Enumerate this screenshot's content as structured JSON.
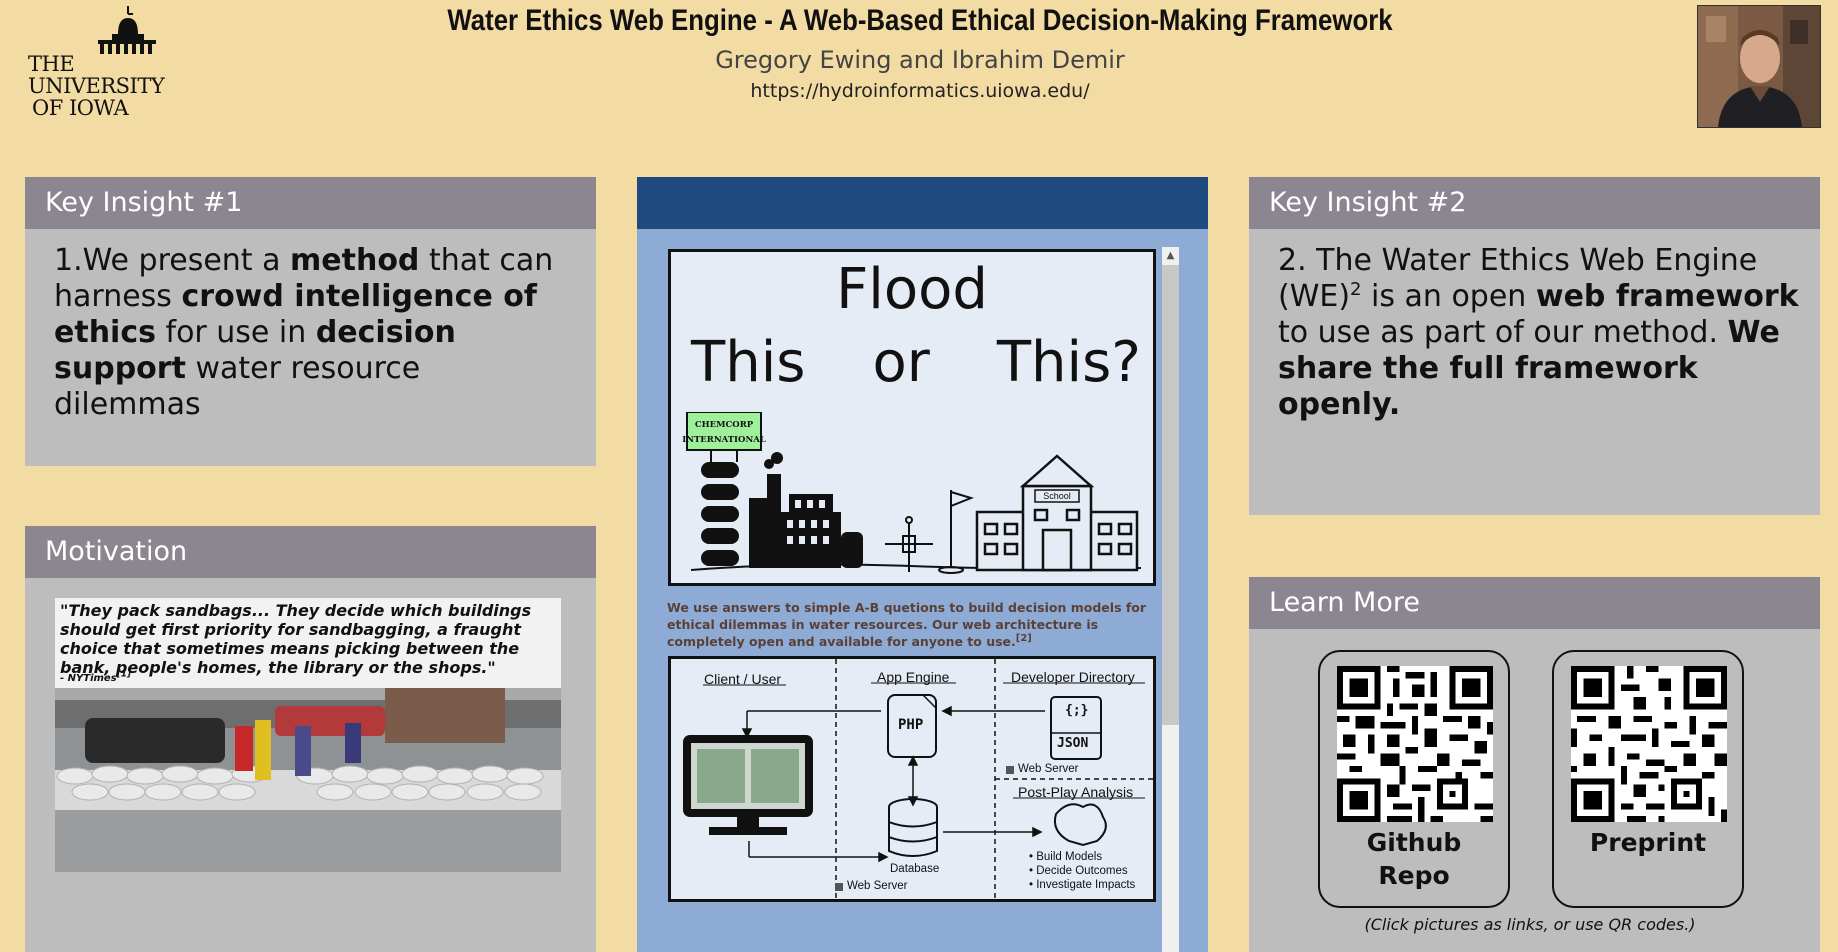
{
  "header": {
    "university_line1": "THE",
    "university_line2": "UNIVERSITY",
    "university_line3": "OF IOWA",
    "title": "Water Ethics Web Engine - A Web-Based Ethical Decision-Making Framework",
    "authors": "Gregory Ewing and Ibrahim Demir",
    "url": "https://hydroinformatics.uiowa.edu/"
  },
  "insight1": {
    "heading": "Key Insight #1",
    "t1": "1.We present a ",
    "b1": "method",
    "t2": " that can harness ",
    "b2": "crowd intelligence of ethics",
    "t3": " for use in ",
    "b3": "decision support",
    "t4": " water resource dilemmas"
  },
  "motivation": {
    "heading": "Motivation",
    "quote": "\"They pack sandbags... They decide which buildings should get first priority for sandbagging, a fraught choice that sometimes means picking between the bank, people's homes, the library or the shops.\"",
    "source": "- NYTimes",
    "source_ref": "[1]"
  },
  "center": {
    "flood": "Flood",
    "this1": "This",
    "or": "or",
    "this2": "This?",
    "sign_line1": "CHEMCORP",
    "sign_line2": "INTERNATIONAL",
    "school_sign": "School",
    "caption": "We use answers to simple A-B quetions to build decision models for ethical dilemmas in water resources. Our web architecture is completely open and available for anyone to use.",
    "caption_ref": "[2]",
    "arch": {
      "client": "Client / User",
      "app": "App Engine",
      "dev": "Developer Directory",
      "php": "PHP",
      "json": "JSON",
      "json_icon": "{;}",
      "web_server_1": "Web Server",
      "web_server_2": "Web Server",
      "post_play": "Post-Play Analysis",
      "database": "Database",
      "bullet1": "Build Models",
      "bullet2": "Decide Outcomes",
      "bullet3": "Investigate Impacts"
    }
  },
  "insight2": {
    "heading": "Key Insight #2",
    "t1": "2. The Water Ethics Web Engine (WE)",
    "sup": "2",
    "t2": " is an open ",
    "b1": "web framework",
    "t3": " to use as part of our method. ",
    "b2": "We share the full framework openly."
  },
  "learn": {
    "heading": "Learn More",
    "github_line1": "Github",
    "github_line2": "Repo",
    "preprint": "Preprint",
    "note": "(Click pictures as links, or use QR codes.)"
  },
  "colors": {
    "background": "#f3dca4",
    "panel": "#bdbdbd",
    "panel_header": "#8b8690",
    "center_bg": "#8dabd4",
    "center_bar": "#1f4a80"
  }
}
